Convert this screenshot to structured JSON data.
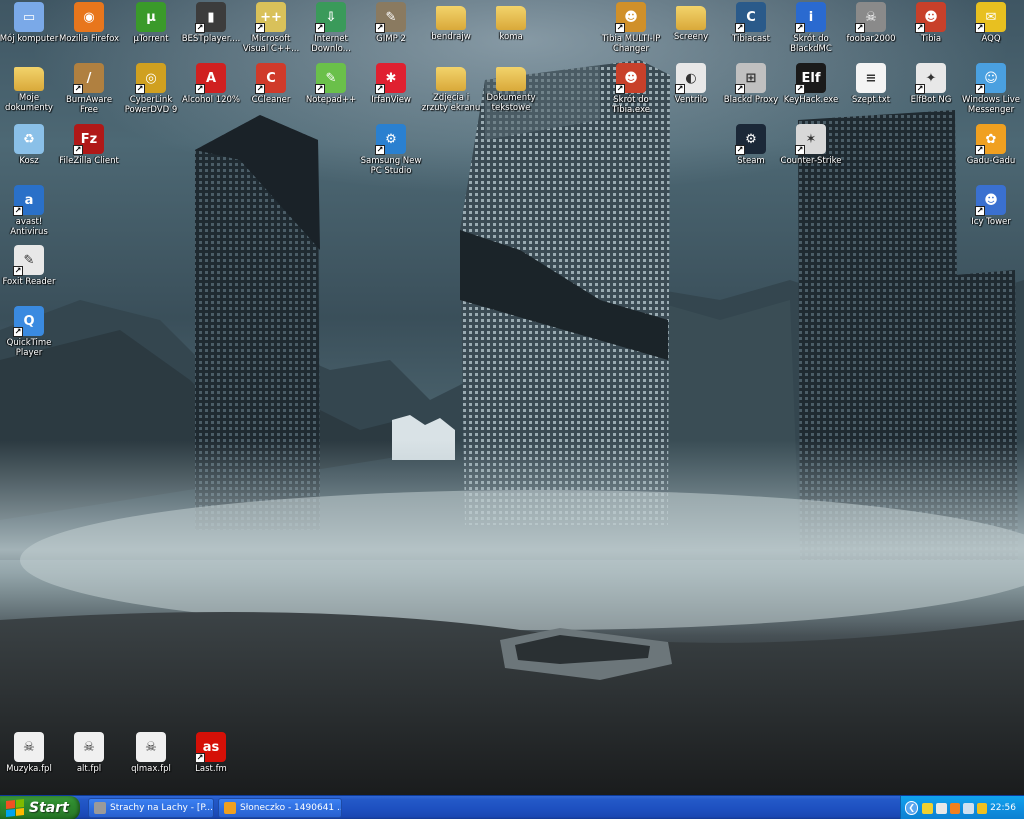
{
  "desktop": {
    "icons": [
      {
        "label": "Mój komputer",
        "icon": "computer-icon",
        "color": "#7aa9e8",
        "glyph": "▭",
        "shortcut": false
      },
      {
        "label": "Mozilla Firefox",
        "icon": "firefox-icon",
        "color": "#e8761c",
        "glyph": "◉",
        "shortcut": false
      },
      {
        "label": "µTorrent",
        "icon": "utorrent-icon",
        "color": "#3a9a2a",
        "glyph": "µ",
        "shortcut": false
      },
      {
        "label": "BESTplayer....",
        "icon": "film-icon",
        "color": "#3c3c3c",
        "glyph": "▮",
        "shortcut": true
      },
      {
        "label": "Microsoft\nVisual C++...",
        "icon": "visual-cpp-icon",
        "color": "#d9c15a",
        "glyph": "++",
        "shortcut": true
      },
      {
        "label": "Internet\nDownlo...",
        "icon": "internet-download-icon",
        "color": "#3a9a5a",
        "glyph": "⇩",
        "shortcut": true
      },
      {
        "label": "GIMP 2",
        "icon": "gimp-icon",
        "color": "#8a7a60",
        "glyph": "✎",
        "shortcut": true
      },
      {
        "label": "bendrajw",
        "icon": "folder-icon",
        "color": "#f2d36b",
        "glyph": "",
        "shortcut": false
      },
      {
        "label": "koma",
        "icon": "folder-icon",
        "color": "#f2d36b",
        "glyph": "",
        "shortcut": false
      },
      {
        "label": "Tibia MULTI-IP\nChanger",
        "icon": "tibia-character-icon",
        "color": "#d0902a",
        "glyph": "☻",
        "shortcut": true
      },
      {
        "label": "Screeny",
        "icon": "folder-icon",
        "color": "#f2d36b",
        "glyph": "",
        "shortcut": false
      },
      {
        "label": "Tibiacast",
        "icon": "tibiacast-icon",
        "color": "#2a5a8a",
        "glyph": "C",
        "shortcut": true
      },
      {
        "label": "Skrót do\nBlackdMC",
        "icon": "info-icon",
        "color": "#2a6ad0",
        "glyph": "i",
        "shortcut": true
      },
      {
        "label": "foobar2000",
        "icon": "skull-icon",
        "color": "#8a8a8a",
        "glyph": "☠",
        "shortcut": true
      },
      {
        "label": "Tibia",
        "icon": "tibia-icon",
        "color": "#c8402a",
        "glyph": "☻",
        "shortcut": true
      },
      {
        "label": "AQQ",
        "icon": "aqq-icon",
        "color": "#e8c020",
        "glyph": "✉",
        "shortcut": true
      },
      {
        "label": "Moje\ndokumenty",
        "icon": "documents-folder-icon",
        "color": "#f2d36b",
        "glyph": "",
        "shortcut": false
      },
      {
        "label": "BurnAware\nFree",
        "icon": "burnaware-icon",
        "color": "#b08040",
        "glyph": "/",
        "shortcut": true
      },
      {
        "label": "CyberLink\nPowerDVD 9",
        "icon": "powerdvd-icon",
        "color": "#d0a020",
        "glyph": "◎",
        "shortcut": true
      },
      {
        "label": "Alcohol 120%",
        "icon": "alcohol-icon",
        "color": "#d02020",
        "glyph": "A",
        "shortcut": true
      },
      {
        "label": "CCleaner",
        "icon": "ccleaner-icon",
        "color": "#d03a2a",
        "glyph": "C",
        "shortcut": true
      },
      {
        "label": "Notepad++",
        "icon": "notepad-plus-icon",
        "color": "#6ac04a",
        "glyph": "✎",
        "shortcut": true
      },
      {
        "label": "IrfanView",
        "icon": "irfanview-icon",
        "color": "#e02030",
        "glyph": "✱",
        "shortcut": true
      },
      {
        "label": "Zdjęcia i\nzrzuty ekranu",
        "icon": "folder-icon",
        "color": "#f2d36b",
        "glyph": "",
        "shortcut": false
      },
      {
        "label": "Dokumenty\ntekstowe",
        "icon": "folder-icon",
        "color": "#f2d36b",
        "glyph": "",
        "shortcut": false
      },
      {
        "label": "Skrót do\nTibia.exe",
        "icon": "tibia-icon",
        "color": "#c8402a",
        "glyph": "☻",
        "shortcut": true
      },
      {
        "label": "Ventrilo",
        "icon": "ventrilo-icon",
        "color": "#e8e8e8",
        "glyph": "◐",
        "shortcut": true
      },
      {
        "label": "Blackd Proxy",
        "icon": "network-icon",
        "color": "#c0c0c0",
        "glyph": "⊞",
        "shortcut": true
      },
      {
        "label": "KeyHack.exe",
        "icon": "elf-bot-icon",
        "color": "#1a1a1a",
        "glyph": "Elf",
        "shortcut": true
      },
      {
        "label": "Szept.txt",
        "icon": "text-file-icon",
        "color": "#f4f4f4",
        "glyph": "≡",
        "shortcut": false
      },
      {
        "label": "ElfBot NG",
        "icon": "elfbot-ng-icon",
        "color": "#e8e8e8",
        "glyph": "✦",
        "shortcut": true
      },
      {
        "label": "Windows Live\nMessenger",
        "icon": "messenger-icon",
        "color": "#4aa0e0",
        "glyph": "☺",
        "shortcut": true
      },
      {
        "label": "Kosz",
        "icon": "recycle-bin-icon",
        "color": "#8ac0e8",
        "glyph": "♻",
        "shortcut": false
      },
      {
        "label": "FileZilla Client",
        "icon": "filezilla-icon",
        "color": "#b01818",
        "glyph": "Fz",
        "shortcut": true
      },
      {
        "label": "Samsung New\nPC Studio",
        "icon": "samsung-icon",
        "color": "#2a80d0",
        "glyph": "⚙",
        "shortcut": true
      },
      {
        "label": "Steam",
        "icon": "steam-icon",
        "color": "#1b2838",
        "glyph": "⚙",
        "shortcut": true
      },
      {
        "label": "Counter-Strike",
        "icon": "counter-strike-icon",
        "color": "#d8d8d8",
        "glyph": "✶",
        "shortcut": true
      },
      {
        "label": "Gadu-Gadu",
        "icon": "gadu-gadu-icon",
        "color": "#f0a020",
        "glyph": "✿",
        "shortcut": true
      },
      {
        "label": "avast!\nAntivirus",
        "icon": "avast-icon",
        "color": "#2a70c8",
        "glyph": "a",
        "shortcut": true
      },
      {
        "label": "Icy Tower",
        "icon": "icy-tower-icon",
        "color": "#3a70d0",
        "glyph": "☻",
        "shortcut": true
      },
      {
        "label": "Foxit Reader",
        "icon": "foxit-icon",
        "color": "#e8e8e8",
        "glyph": "✎",
        "shortcut": true
      },
      {
        "label": "QuickTime\nPlayer",
        "icon": "quicktime-icon",
        "color": "#3a8ae0",
        "glyph": "Q",
        "shortcut": true
      },
      {
        "label": "Muzyka.fpl",
        "icon": "playlist-file-icon",
        "color": "#f0f0f0",
        "glyph": "☠",
        "shortcut": false
      },
      {
        "label": "alt.fpl",
        "icon": "playlist-file-icon",
        "color": "#f0f0f0",
        "glyph": "☠",
        "shortcut": false
      },
      {
        "label": "qlmax.fpl",
        "icon": "playlist-file-icon",
        "color": "#f0f0f0",
        "glyph": "☠",
        "shortcut": false
      },
      {
        "label": "Last.fm",
        "icon": "lastfm-icon",
        "color": "#d51007",
        "glyph": "as",
        "shortcut": true
      }
    ]
  },
  "taskbar": {
    "start_label": "Start",
    "tasks": [
      {
        "label": "Strachy na Lachy - [P...",
        "icon": "foobar-task-icon",
        "color": "#9a9a9a"
      },
      {
        "label": "Słoneczko - 1490641 ...",
        "icon": "gadu-gadu-task-icon",
        "color": "#f0a020"
      }
    ],
    "tray": {
      "icons": [
        {
          "icon": "elfbot-tray-icon",
          "color": "#f0d030"
        },
        {
          "icon": "volume-tray-icon",
          "color": "#e8e8e8"
        },
        {
          "icon": "avast-tray-icon",
          "color": "#f08020"
        },
        {
          "icon": "network-tray-icon",
          "color": "#d0e0f0"
        },
        {
          "icon": "gadu-gadu-tray-icon",
          "color": "#f0c020"
        }
      ],
      "clock": "22:56"
    }
  }
}
